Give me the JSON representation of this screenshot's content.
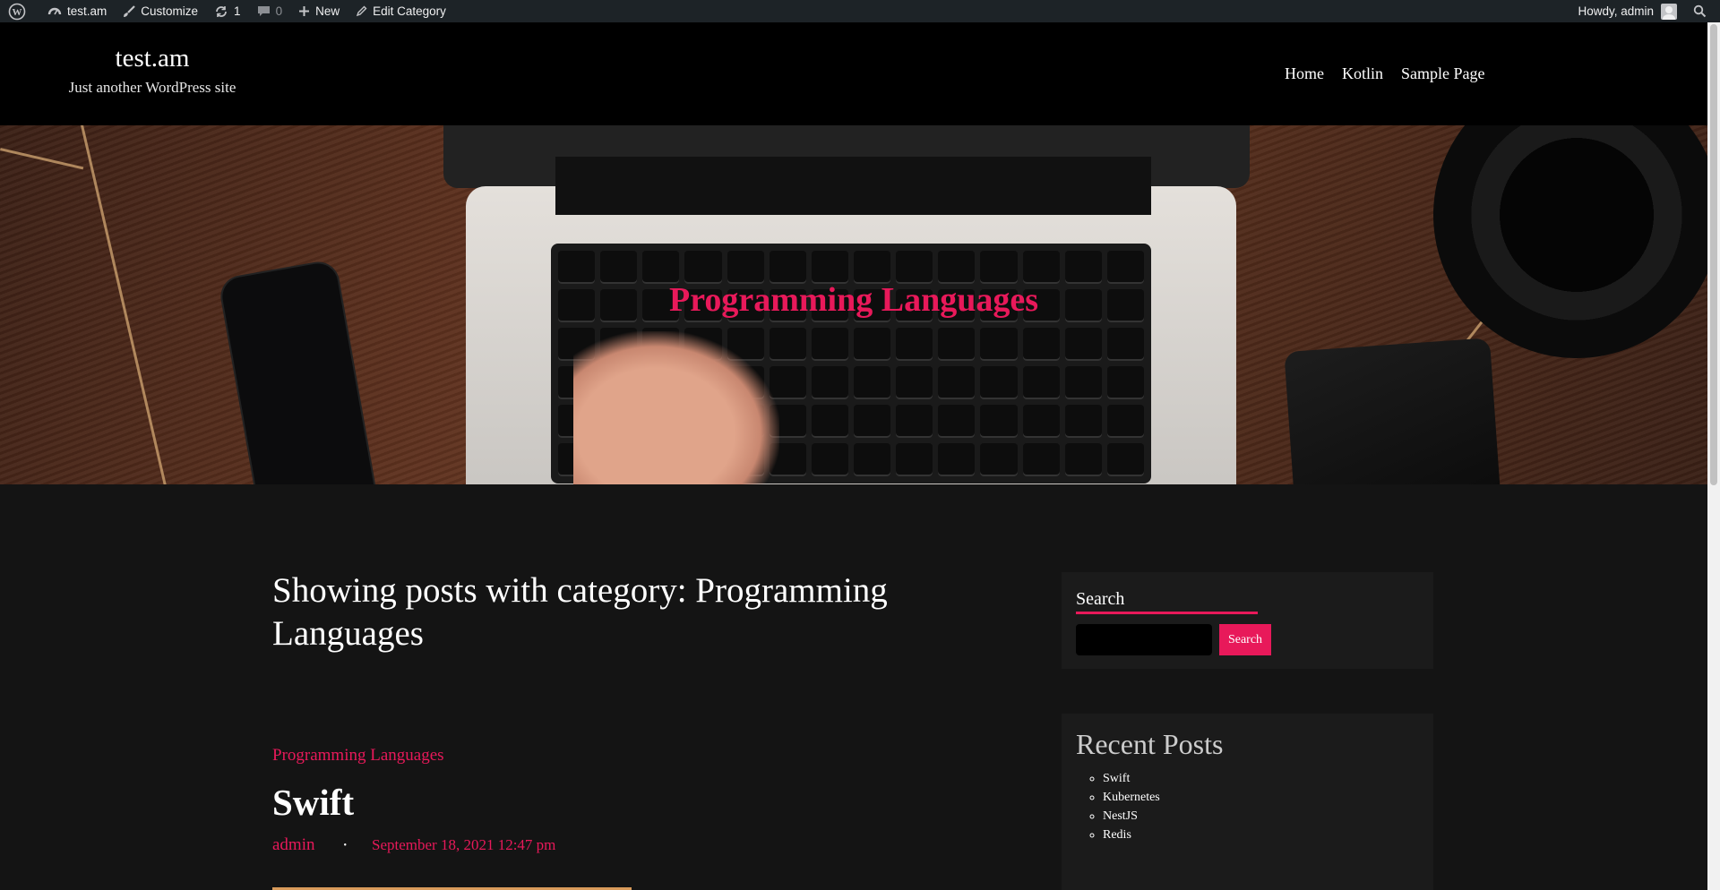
{
  "adminbar": {
    "site": "test.am",
    "customize": "Customize",
    "updates": "1",
    "comments": "0",
    "new": "New",
    "edit": "Edit Category",
    "howdy": "Howdy, admin"
  },
  "header": {
    "site_title": "test.am",
    "tagline": "Just another WordPress site",
    "nav": [
      "Home",
      "Kotlin",
      "Sample Page"
    ]
  },
  "hero": {
    "title": "Programming Languages"
  },
  "archive": {
    "title": "Showing posts with category: Programming Languages"
  },
  "post": {
    "category": "Programming Languages",
    "title": "Swift",
    "author": "admin",
    "separator": "•",
    "date": "September 18, 2021 12:47 pm"
  },
  "sidebar": {
    "search": {
      "title": "Search",
      "placeholder": "",
      "button": "Search"
    },
    "recent": {
      "title": "Recent Posts",
      "items": [
        "Swift",
        "Kubernetes",
        "NestJS",
        "Redis"
      ]
    }
  },
  "colors": {
    "accent": "#e8195a",
    "adminbar": "#1d2327",
    "background": "#141414"
  }
}
